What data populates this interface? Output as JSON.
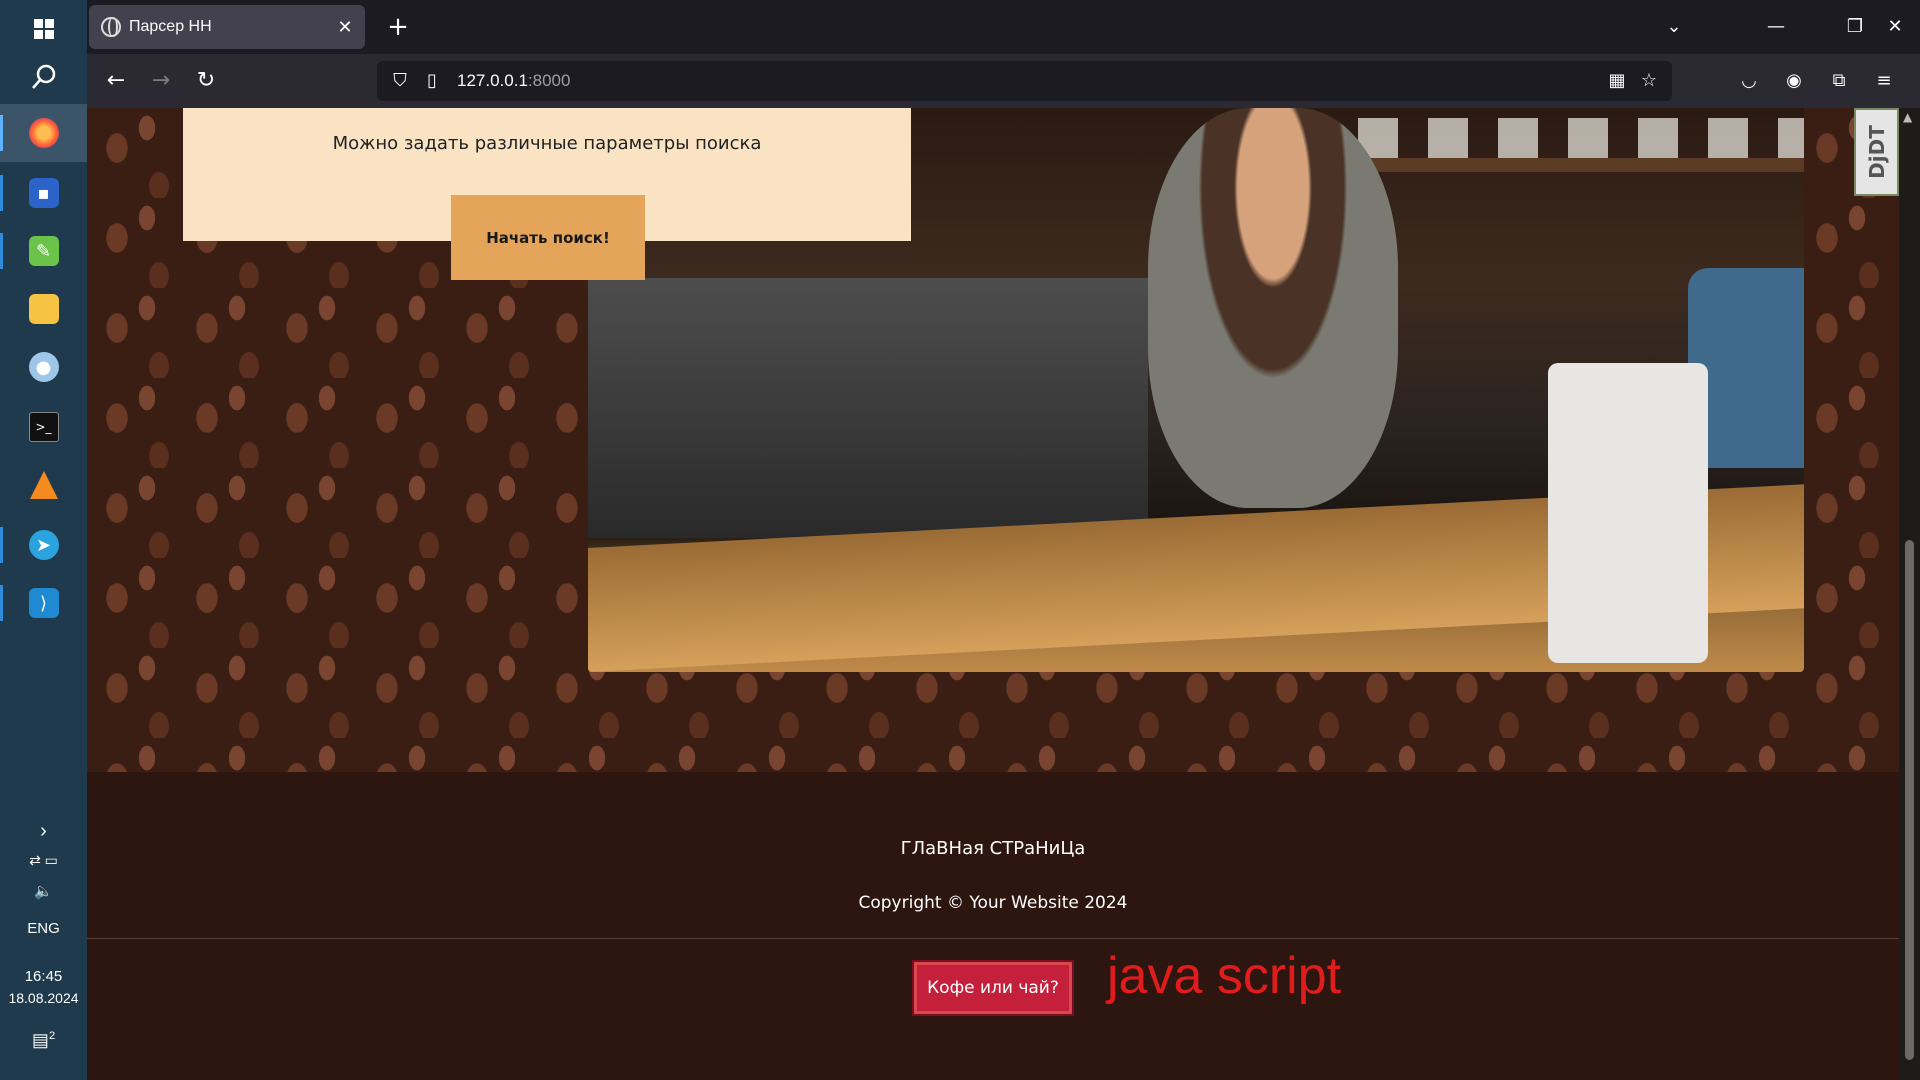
{
  "taskbar": {
    "language": "ENG",
    "time": "16:45",
    "date": "18.08.2024",
    "notification_count": "2"
  },
  "browser": {
    "tab_title": "Парсер НН",
    "url_host": "127.0.0.1",
    "url_port": ":8000"
  },
  "page": {
    "search_description": "Можно задать различные параметры поиска",
    "start_search_label": "Начать поиск!",
    "debug_toolbar_label": "DjDT",
    "footer": {
      "home_link": "ГЛаВНая СТРаНиЦа",
      "copyright": "Copyright © Your Website 2024",
      "coffee_button": "Кофе или чай?",
      "js_note": "java script"
    }
  },
  "colors": {
    "accent_button": "#e4a55b",
    "card_bg": "#fae3c3",
    "footer_bg": "#2d160f",
    "coffee_button": "#c4203b",
    "js_note": "#e11c1c"
  }
}
